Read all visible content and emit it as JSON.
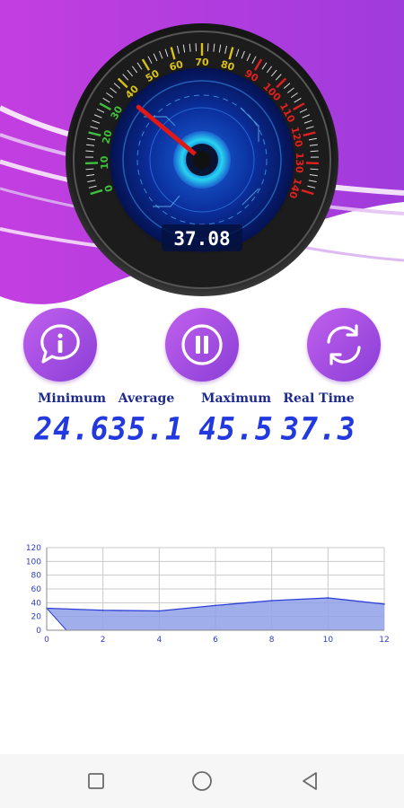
{
  "speedometer": {
    "readout": "37.08",
    "needle_value": 37.08,
    "scale_max": 140,
    "ticks": [
      "0",
      "10",
      "20",
      "30",
      "40",
      "50",
      "60",
      "70",
      "80",
      "90",
      "100",
      "110",
      "120",
      "130",
      "140"
    ]
  },
  "actions": {
    "info_icon": "info-icon",
    "pause_icon": "pause-icon",
    "refresh_icon": "refresh-icon",
    "accent_color": "#a54fe3"
  },
  "stats": [
    {
      "label": "Minimum",
      "value": "24.6"
    },
    {
      "label": "Average",
      "value": "35.1"
    },
    {
      "label": "Maximum",
      "value": "45.5"
    },
    {
      "label": "Real Time",
      "value": "37.3"
    }
  ],
  "chart_data": {
    "type": "area",
    "x": [
      0,
      2,
      4,
      6,
      8,
      10,
      12
    ],
    "values": [
      32,
      29,
      28,
      36,
      43,
      47,
      38
    ],
    "xlim": [
      0,
      12
    ],
    "ylim": [
      0,
      120
    ],
    "xticks": [
      "0",
      "2",
      "4",
      "6",
      "8",
      "10",
      "12"
    ],
    "yticks": [
      "0",
      "20",
      "40",
      "60",
      "80",
      "100",
      "120"
    ],
    "grid": true,
    "fill_color": "#8fa0e8",
    "line_color": "#2c3fd6"
  },
  "navbar": {
    "recents_icon": "square-icon",
    "home_icon": "circle-icon",
    "back_icon": "triangle-back-icon"
  }
}
